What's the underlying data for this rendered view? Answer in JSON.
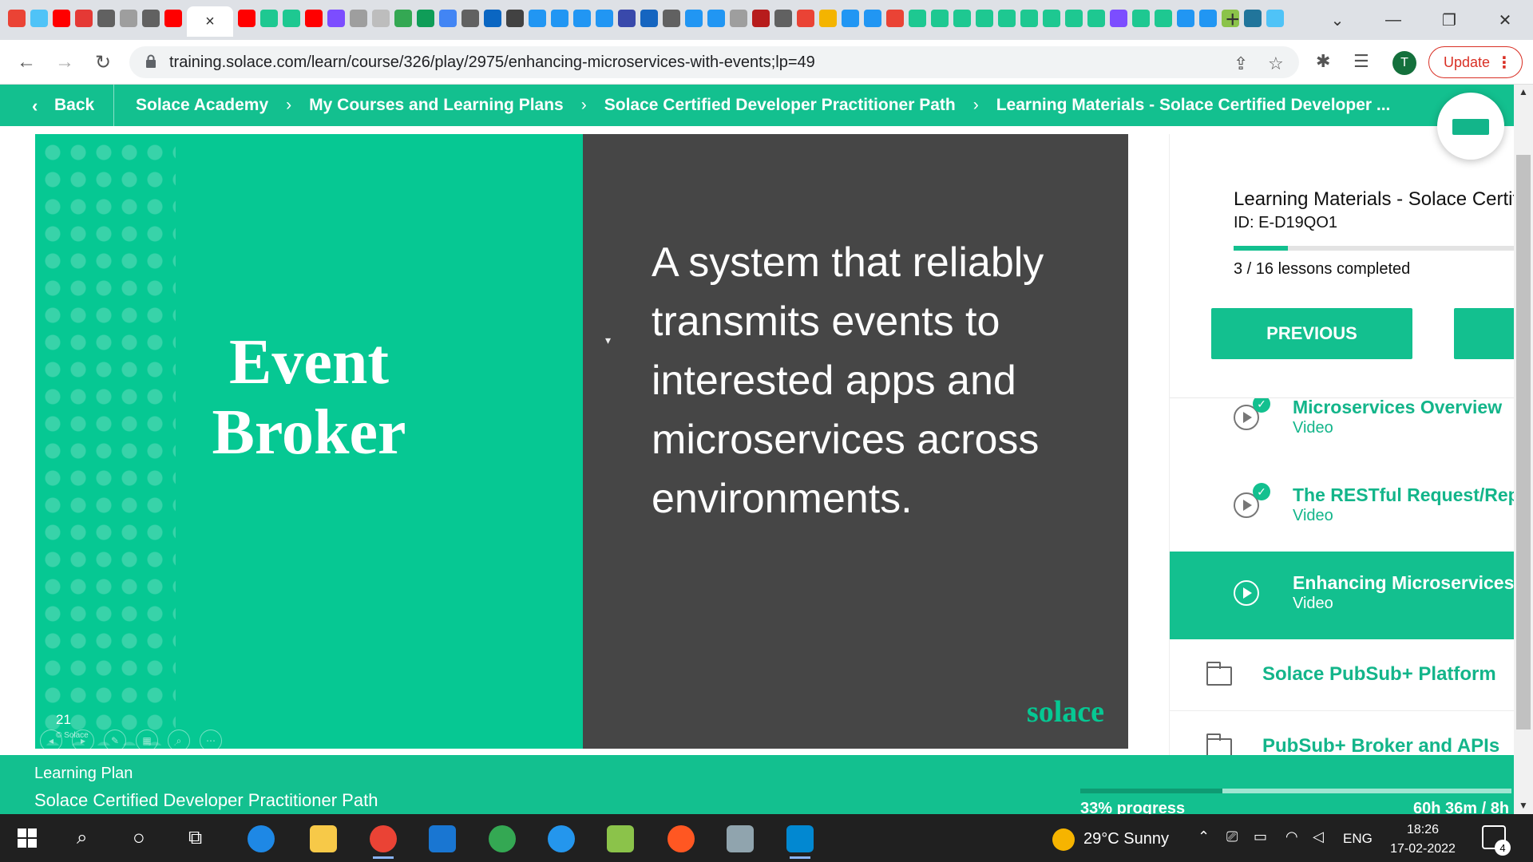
{
  "browser": {
    "url": "training.solace.com/learn/course/326/play/2975/enhancing-microservices-with-events;lp=49",
    "update_label": "Update",
    "profile_initial": "T",
    "new_tab": "+",
    "close_tab": "×",
    "tab_colors": [
      "#ea4335",
      "#4fc3f7",
      "#ff0000",
      "#e53935",
      "#616161",
      "#9e9e9e",
      "#616161",
      "#ff0000",
      "#ff0000",
      "#1ec891",
      "#1ec891",
      "#ff0000",
      "#7c4dff",
      "#9e9e9e",
      "#bdbdbd",
      "#34a853",
      "#0f9d58",
      "#4285f4",
      "#616161",
      "#0a66c2",
      "#424242",
      "#2196f3",
      "#2196f3",
      "#2196f3",
      "#2196f3",
      "#3949ab",
      "#1565c0",
      "#616161",
      "#2196f3",
      "#2196f3",
      "#9e9e9e",
      "#b71c1c",
      "#616161",
      "#ea4335",
      "#f4b400",
      "#2196f3",
      "#2196f3",
      "#ea4335",
      "#1ec891",
      "#1ec891",
      "#1ec891",
      "#1ec891",
      "#1ec891",
      "#1ec891",
      "#1ec891",
      "#1ec891",
      "#1ec891",
      "#7c4dff",
      "#1ec891",
      "#1ec891",
      "#2196f3",
      "#2196f3",
      "#8bc34a",
      "#21759b",
      "#4fc3f7"
    ]
  },
  "breadcrumb": {
    "back": "Back",
    "items": [
      "Solace Academy",
      "My Courses and Learning Plans",
      "Solace Certified Developer Practitioner Path",
      "Learning Materials - Solace Certified Developer ..."
    ]
  },
  "slide": {
    "title_line1": "Event",
    "title_line2": "Broker",
    "body": "A system that reliably transmits events to interested apps and microservices across environments.",
    "logo": "solace",
    "number": "21",
    "copyright": "© Solace"
  },
  "sidebar": {
    "title": "Learning Materials - Solace Certified Developer",
    "id": "ID: E-D19QO1",
    "progress_fraction": 0.19,
    "lessons_completed": "3 / 16 lessons completed",
    "previous_label": "PREVIOUS",
    "lessons": [
      {
        "title": "Microservices Overview",
        "type": "Video",
        "completed": true,
        "active": false
      },
      {
        "title": "The RESTful Request/Reply",
        "type": "Video",
        "completed": true,
        "active": false
      },
      {
        "title": "Enhancing Microservices with Events",
        "type": "Video",
        "completed": false,
        "active": true
      }
    ],
    "folders": [
      "Solace PubSub+ Platform",
      "PubSub+ Broker and APIs"
    ]
  },
  "footer": {
    "label": "Learning Plan",
    "name": "Solace Certified Developer Practitioner Path",
    "progress_pct": 33,
    "progress_label": "33% progress",
    "time": "60h 36m / 8h"
  },
  "taskbar": {
    "weather": "29°C  Sunny",
    "lang": "ENG",
    "time": "18:26",
    "date": "17-02-2022",
    "notifications": "4"
  }
}
